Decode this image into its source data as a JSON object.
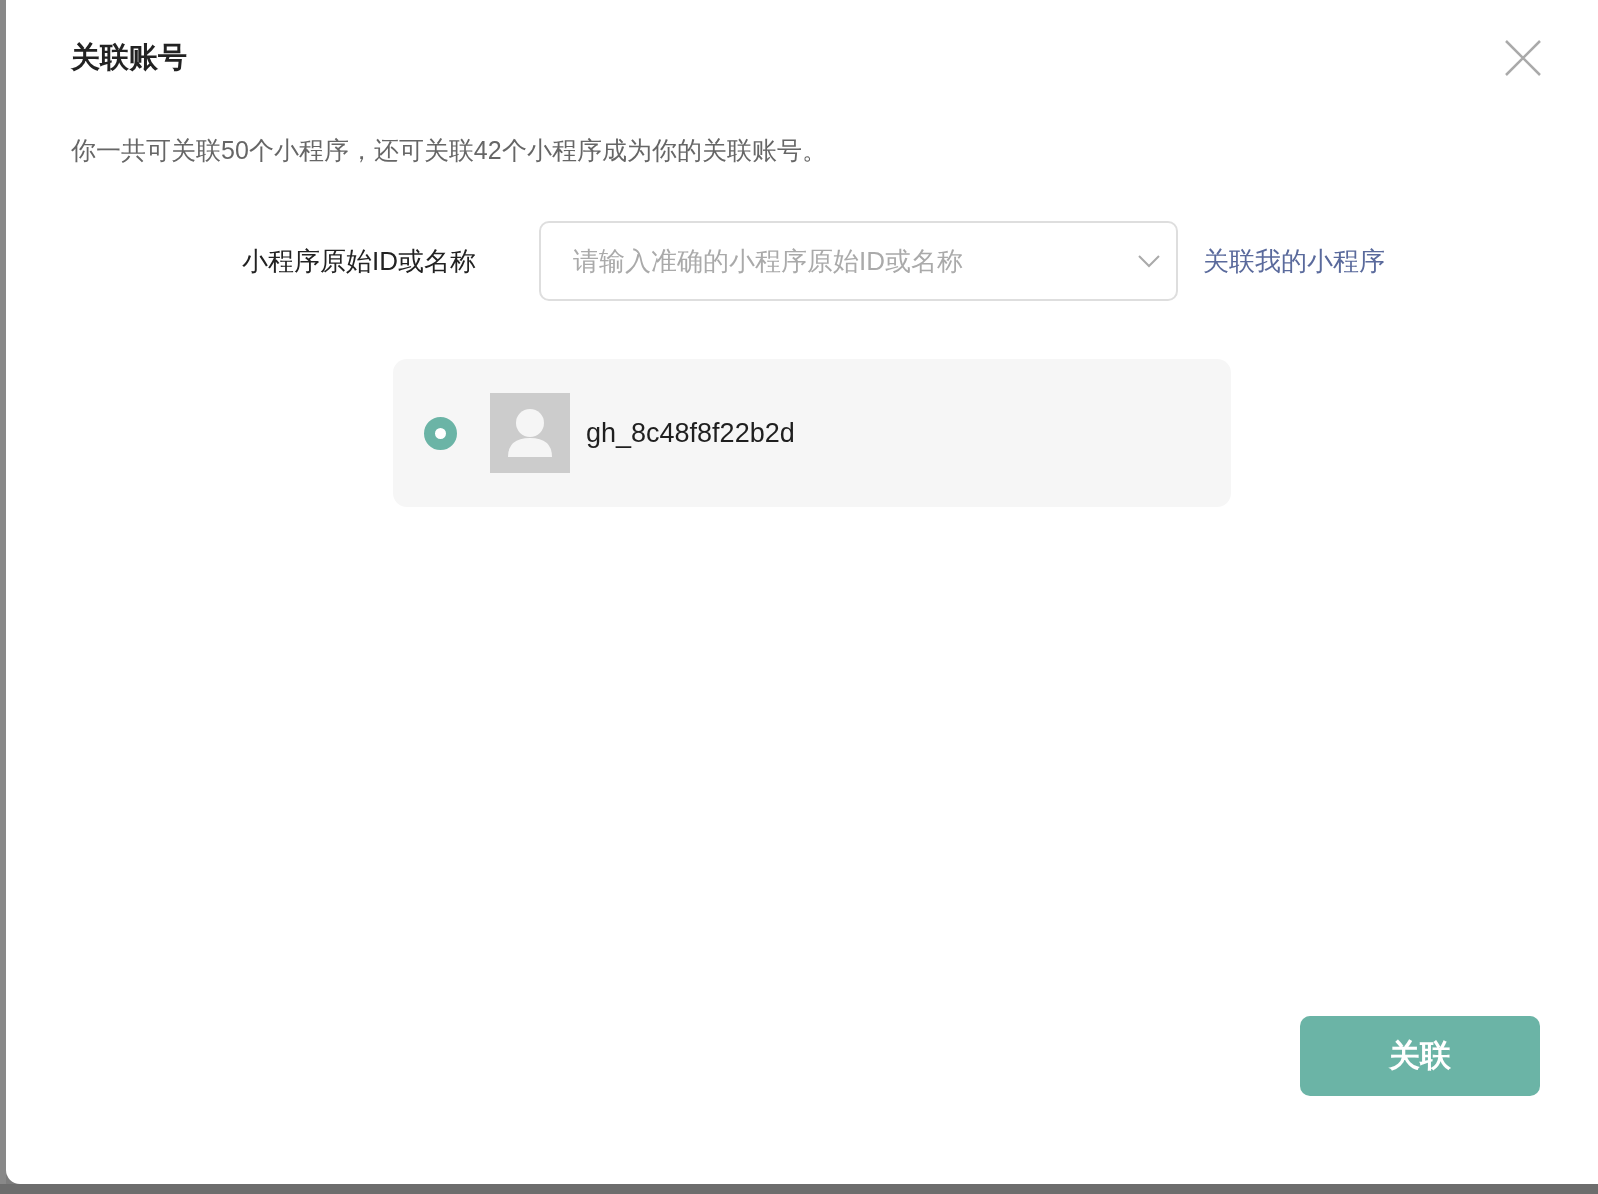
{
  "dialog": {
    "title": "关联账号",
    "description": "你一共可关联50个小程序，还可关联42个小程序成为你的关联账号。"
  },
  "form": {
    "label": "小程序原始ID或名称",
    "placeholder": "请输入准确的小程序原始ID或名称",
    "link": "关联我的小程序"
  },
  "results": [
    {
      "name": "gh_8c48f8f22b2d",
      "selected": true
    }
  ],
  "buttons": [
    {
      "label": "关联",
      "kind": "primary"
    }
  ]
}
